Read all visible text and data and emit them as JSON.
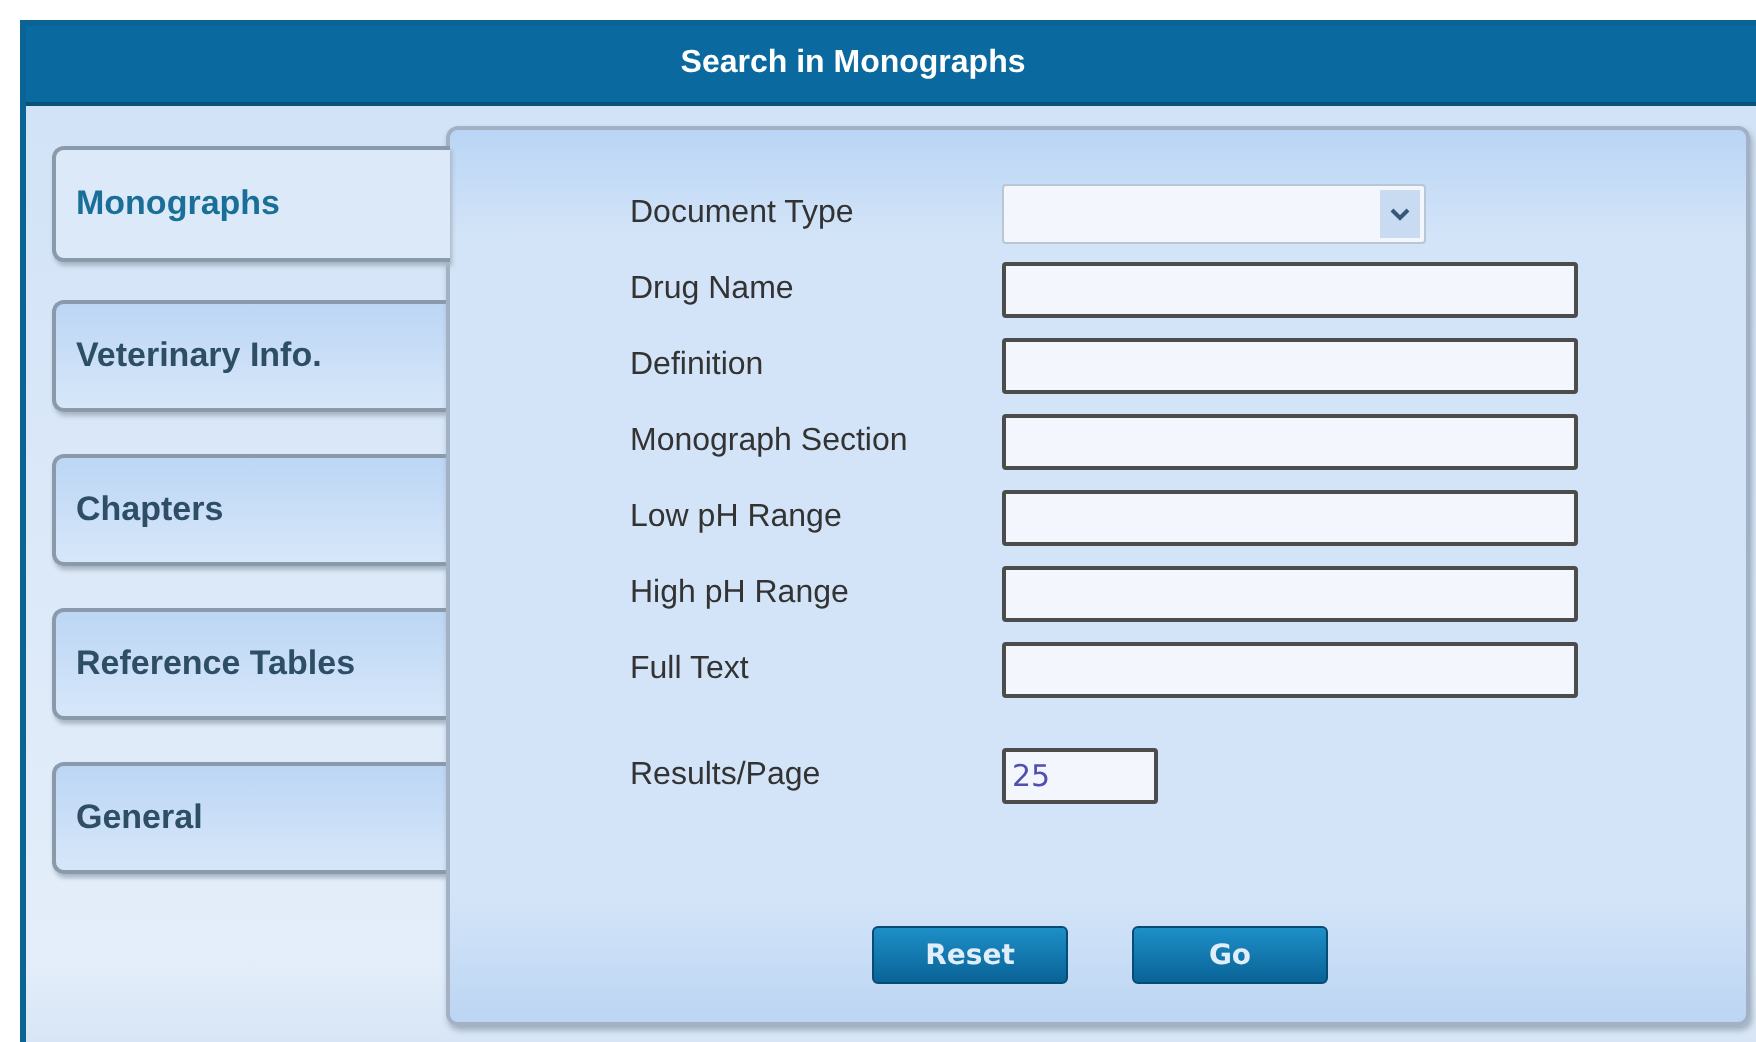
{
  "window": {
    "title": "Search in Monographs"
  },
  "tabs": [
    {
      "label": "Monographs",
      "selected": true
    },
    {
      "label": "Veterinary Info.",
      "selected": false
    },
    {
      "label": "Chapters",
      "selected": false
    },
    {
      "label": "Reference Tables",
      "selected": false
    },
    {
      "label": "General",
      "selected": false
    }
  ],
  "fields": [
    {
      "kind": "select",
      "label": "Document Type"
    },
    {
      "kind": "text",
      "label": "Drug Name"
    },
    {
      "kind": "text",
      "label": "Definition"
    },
    {
      "kind": "text",
      "label": "Monograph Section"
    },
    {
      "kind": "text",
      "label": "Low pH Range"
    },
    {
      "kind": "text",
      "label": "High pH Range"
    },
    {
      "kind": "text",
      "label": "Full Text"
    },
    {
      "kind": "number",
      "label": "Results/Page",
      "value": "25"
    }
  ],
  "buttons": [
    "Reset",
    "Go"
  ]
}
